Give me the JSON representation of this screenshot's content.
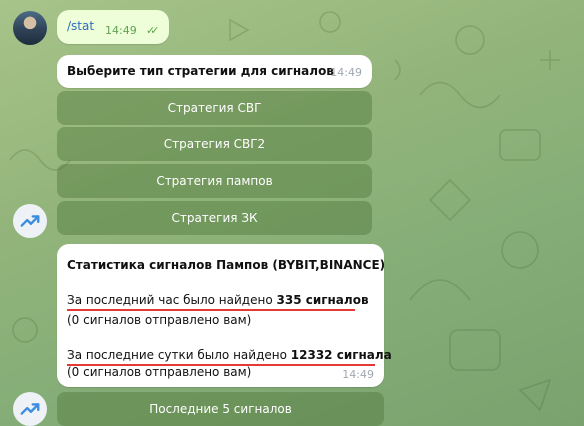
{
  "chat": {
    "outgoing": {
      "text": "/stat",
      "time": "14:49",
      "status": "✓✓"
    },
    "prompt": {
      "text": "Выберите тип стратегии для сигналов",
      "time": "14:49"
    },
    "strategy_buttons": [
      "Стратегия СВГ",
      "Стратегия СВГ2",
      "Стратегия пампов",
      "Стратегия ЗК"
    ],
    "stats": {
      "title": "Статистика сигналов Пампов (BYBIT,BINANCE)",
      "hour_prefix": "За последний час было найдено ",
      "hour_count": "335 сигналов",
      "hour_sent": "(0 сигналов отправлено вам)",
      "day_prefix": "За последние сутки было найдено ",
      "day_count": "12332 сигнала",
      "day_sent": "(0 сигналов отправлено вам)",
      "time": "14:49"
    },
    "last_button": "Последние 5 сигналов"
  },
  "icons": {
    "bot_avatar": "trending-up-icon",
    "user_avatar": "user-photo",
    "read_status": "double-check-icon"
  },
  "colors": {
    "accent": "#2a6dbd",
    "highlight_underline": "#e53935",
    "button_bg": "#6e9a5b"
  }
}
